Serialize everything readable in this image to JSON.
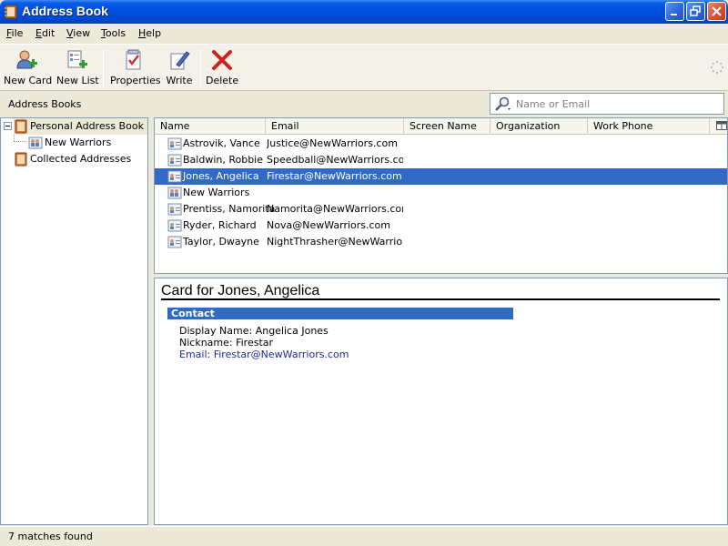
{
  "window": {
    "title": "Address Book"
  },
  "menu": [
    {
      "label": "File",
      "key": "F",
      "rest": "ile"
    },
    {
      "label": "Edit",
      "key": "E",
      "rest": "dit"
    },
    {
      "label": "View",
      "key": "V",
      "rest": "iew"
    },
    {
      "label": "Tools",
      "key": "T",
      "rest": "ools"
    },
    {
      "label": "Help",
      "key": "H",
      "rest": "elp"
    }
  ],
  "toolbar": {
    "new_card": "New Card",
    "new_list": "New List",
    "properties": "Properties",
    "write": "Write",
    "delete": "Delete"
  },
  "address_books": {
    "label": "Address Books",
    "tree": [
      {
        "label": "Personal Address Book",
        "icon": "address-book-icon"
      },
      {
        "label": "New Warriors",
        "icon": "mailing-list-icon"
      },
      {
        "label": "Collected Addresses",
        "icon": "address-book-icon"
      }
    ]
  },
  "search": {
    "placeholder": "Name or Email",
    "value": ""
  },
  "results": {
    "columns": [
      "Name",
      "Email",
      "Screen Name",
      "Organization",
      "Work Phone"
    ],
    "rows": [
      {
        "name": "Astrovik, Vance",
        "email": "Justice@NewWarriors.com",
        "icon": "contact-card-icon",
        "selected": false
      },
      {
        "name": "Baldwin, Robbie",
        "email": "Speedball@NewWarriors.com",
        "icon": "contact-card-icon",
        "selected": false
      },
      {
        "name": "Jones, Angelica",
        "email": "Firestar@NewWarriors.com",
        "icon": "contact-card-icon",
        "selected": true
      },
      {
        "name": "New Warriors",
        "email": "",
        "icon": "mailing-list-icon",
        "selected": false
      },
      {
        "name": "Prentiss, Namorita",
        "email": "Namorita@NewWarriors.com",
        "icon": "contact-card-icon",
        "selected": false
      },
      {
        "name": "Ryder, Richard",
        "email": "Nova@NewWarriors.com",
        "icon": "contact-card-icon",
        "selected": false
      },
      {
        "name": "Taylor, Dwayne",
        "email": "NightThrasher@NewWarrior…",
        "icon": "contact-card-icon",
        "selected": false
      }
    ]
  },
  "card": {
    "title": "Card for Jones, Angelica",
    "section": "Contact",
    "display_name": "Display Name: Angelica Jones",
    "nickname": "Nickname: Firestar",
    "email": "Email: Firestar@NewWarriors.com"
  },
  "status": {
    "text": "7 matches found"
  },
  "colors": {
    "selection": "#316ac5",
    "titlebar": "#0051e0",
    "link": "#1c2a9a"
  }
}
